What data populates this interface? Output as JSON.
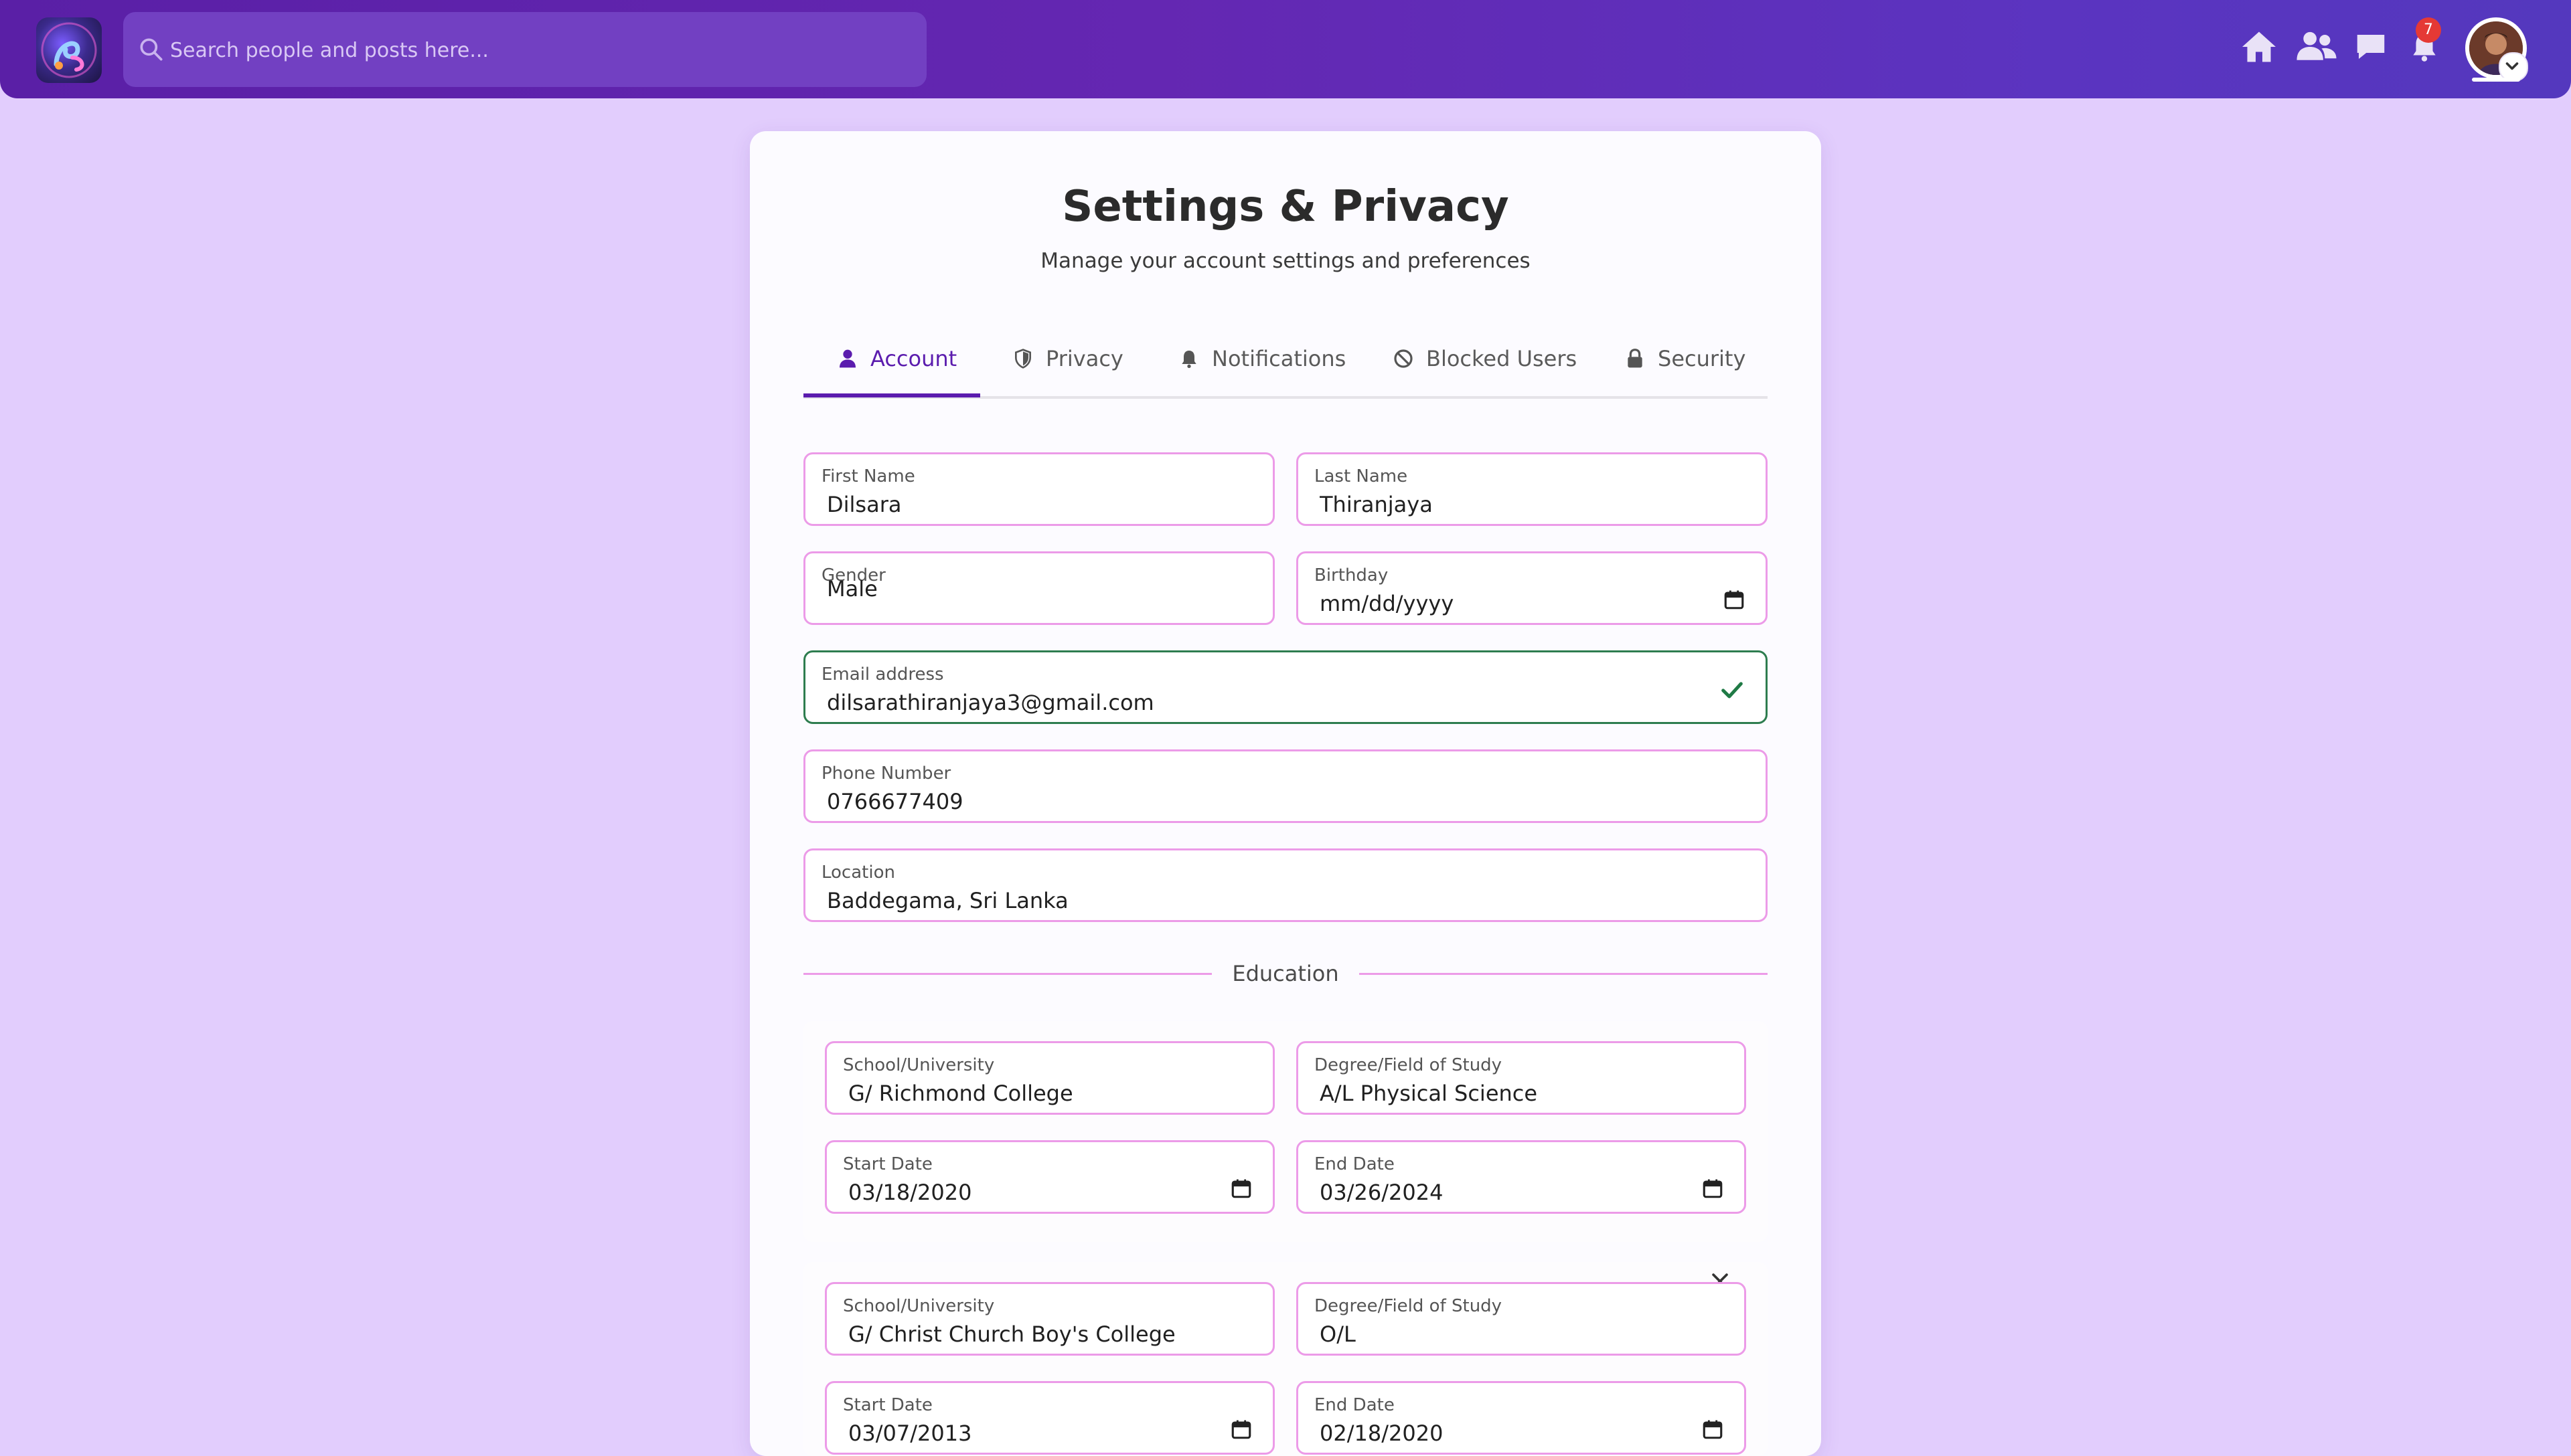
{
  "header": {
    "search_placeholder": "Search people and posts here...",
    "notification_count": "7",
    "icons": [
      "home-icon",
      "friends-icon",
      "chat-icon",
      "bell-icon",
      "avatar"
    ]
  },
  "page": {
    "title": "Settings & Privacy",
    "subtitle": "Manage your account settings and preferences"
  },
  "tabs": [
    {
      "label": "Account",
      "icon": "user-icon",
      "active": true
    },
    {
      "label": "Privacy",
      "icon": "shield-icon"
    },
    {
      "label": "Notifications",
      "icon": "bell-icon"
    },
    {
      "label": "Blocked Users",
      "icon": "block-icon"
    },
    {
      "label": "Security",
      "icon": "lock-icon"
    }
  ],
  "account": {
    "first_name": {
      "label": "First Name",
      "value": "Dilsara"
    },
    "last_name": {
      "label": "Last Name",
      "value": "Thiranjaya"
    },
    "gender": {
      "label": "Gender",
      "value": "Male"
    },
    "birthday": {
      "label": "Birthday",
      "value": "mm/dd/yyyy"
    },
    "email": {
      "label": "Email address",
      "value": "dilsarathiranjaya3@gmail.com"
    },
    "phone": {
      "label": "Phone Number",
      "value": "0766677409"
    },
    "location": {
      "label": "Location",
      "value": "Baddegama, Sri Lanka"
    }
  },
  "education": {
    "heading": "Education",
    "entries": [
      {
        "school_label": "School/University",
        "school": "G/ Richmond College",
        "degree_label": "Degree/Field of Study",
        "degree": "A/L Physical Science",
        "start_label": "Start Date",
        "start": "03/18/2020",
        "end_label": "End Date",
        "end": "03/26/2024"
      },
      {
        "school_label": "School/University",
        "school": "G/ Christ Church Boy's College",
        "degree_label": "Degree/Field of Study",
        "degree": "O/L",
        "start_label": "Start Date",
        "start": "03/07/2013",
        "end_label": "End Date",
        "end": "02/18/2020"
      }
    ]
  },
  "colors": {
    "accent": "#5b1cae",
    "field_border": "#ec9be8",
    "valid_border": "#2e7d4f",
    "page_bg": "#e2cdfd",
    "badge": "#e53935"
  }
}
